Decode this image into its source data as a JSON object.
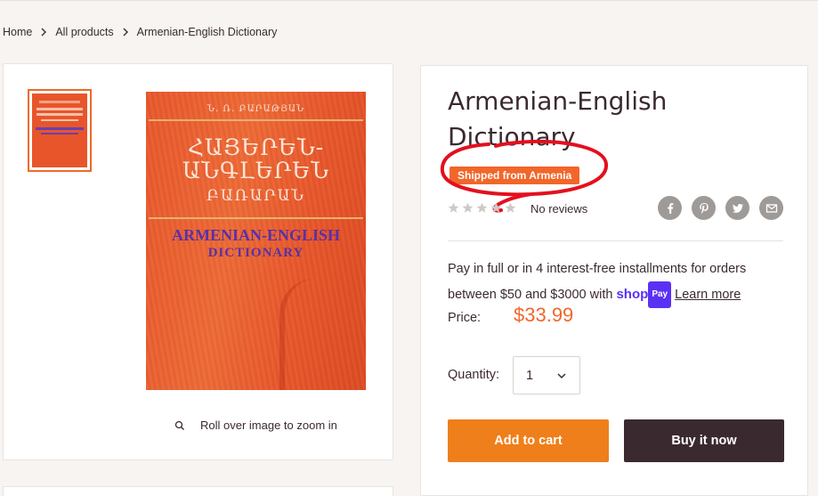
{
  "breadcrumb": {
    "items": [
      {
        "label": "Home"
      },
      {
        "label": "All products"
      },
      {
        "label": "Armenian-English Dictionary"
      }
    ]
  },
  "gallery": {
    "zoom_hint": "Roll over image to zoom in",
    "cover": {
      "author": "Ն. Ռ. ԲԱՐԱԹՅԱՆ",
      "armenian_line1": "ՀԱՅԵՐԵՆ-",
      "armenian_line2": "ԱՆԳԼԵՐԵՆ",
      "armenian_line3": "ԲԱՌԱՐԱՆ",
      "english_line1": "ARMENIAN-ENGLISH",
      "english_line2": "DICTIONARY"
    }
  },
  "product": {
    "title": "Armenian-English Dictionary",
    "badge": "Shipped from Armenia",
    "rating": 0,
    "reviews_label": "No reviews",
    "share": [
      {
        "icon": "facebook-icon"
      },
      {
        "icon": "pinterest-icon"
      },
      {
        "icon": "twitter-icon"
      },
      {
        "icon": "email-icon"
      }
    ],
    "installments": {
      "text": "Pay in full or in 4 interest-free installments for orders between $50 and $3000 with",
      "shop_label": "shop",
      "pay_label": "Pay",
      "learn_more": "Learn more"
    },
    "price_label": "Price:",
    "price": "$33.99",
    "quantity_label": "Quantity:",
    "quantity_value": "1",
    "add_to_cart": "Add to cart",
    "buy_now": "Buy it now"
  },
  "colors": {
    "accent": "#f2662a",
    "cart_button": "#ef7f1a",
    "buy_button": "#3a2a2f",
    "annotation": "#e3101e",
    "shop_pay": "#5a31f4"
  }
}
